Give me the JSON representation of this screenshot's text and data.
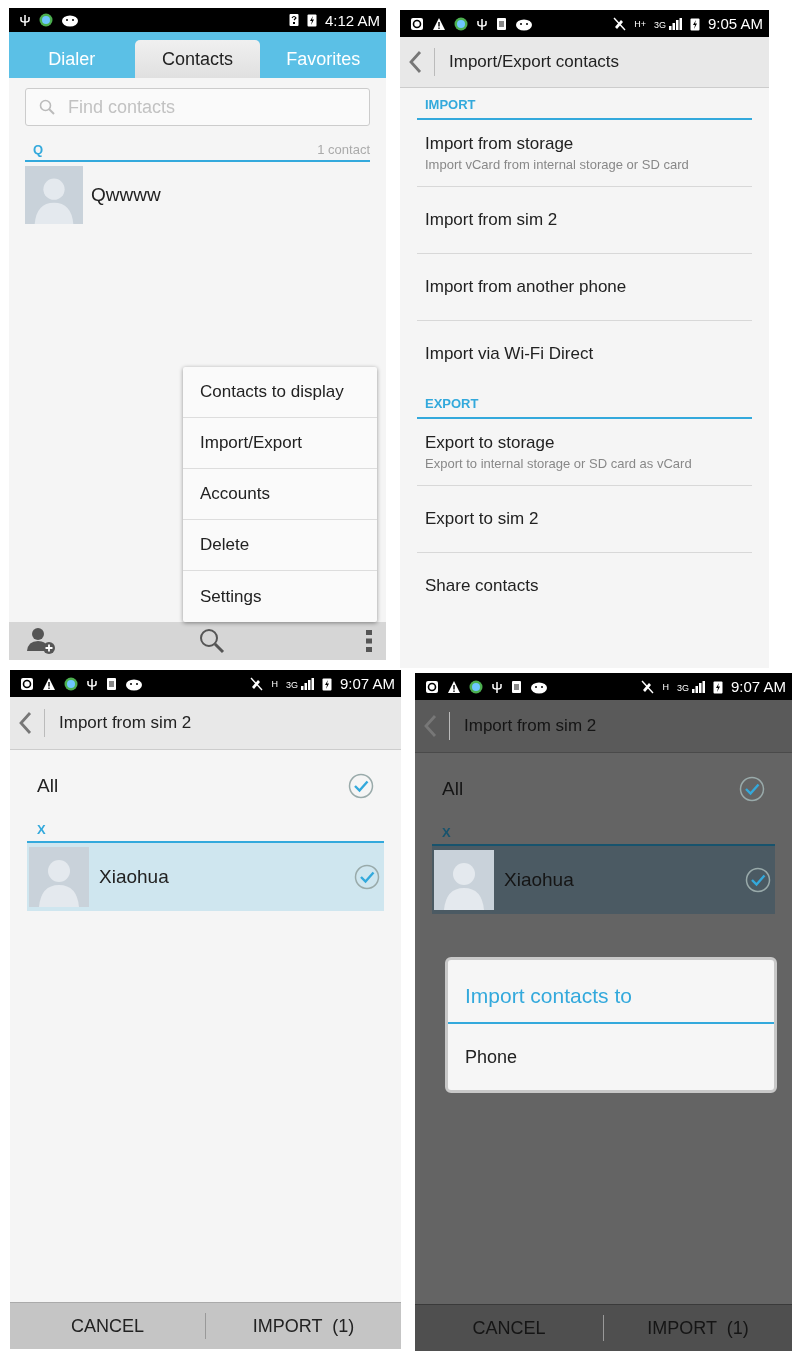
{
  "contacts_screen": {
    "status_bar": {
      "time": "4:12 AM"
    },
    "tabs": [
      {
        "label": "Dialer",
        "selected": false
      },
      {
        "label": "Contacts",
        "selected": true
      },
      {
        "label": "Favorites",
        "selected": false
      }
    ],
    "search": {
      "placeholder": "Find contacts"
    },
    "section": {
      "letter": "Q",
      "count": "1 contact"
    },
    "contacts": [
      {
        "name": "Qwwww"
      }
    ],
    "menu": [
      "Contacts to display",
      "Import/Export",
      "Accounts",
      "Delete",
      "Settings"
    ]
  },
  "import_export_screen": {
    "status_bar": {
      "network": "H+",
      "signal_type": "3G",
      "time": "9:05 AM"
    },
    "title": "Import/Export contacts",
    "sections": [
      {
        "heading": "IMPORT",
        "items": [
          {
            "title": "Import from storage",
            "subtitle": "Import vCard from internal storage or SD card"
          },
          {
            "title": "Import from sim 2"
          },
          {
            "title": "Import from another phone"
          },
          {
            "title": "Import via Wi-Fi Direct"
          }
        ]
      },
      {
        "heading": "EXPORT",
        "items": [
          {
            "title": "Export to storage",
            "subtitle": "Export to internal storage or SD card as vCard"
          },
          {
            "title": "Export to sim 2"
          },
          {
            "title": "Share contacts"
          }
        ]
      }
    ]
  },
  "import_sim_screen": {
    "status_bar": {
      "network": "H",
      "signal_type": "3G",
      "time": "9:07 AM"
    },
    "title": "Import from sim 2",
    "all": {
      "label": "All",
      "checked": true
    },
    "section": "X",
    "contacts": [
      {
        "name": "Xiaohua",
        "checked": true,
        "selected": true
      }
    ],
    "buttons": [
      "CANCEL",
      "IMPORT  (1)"
    ]
  },
  "import_dialog_screen": {
    "status_bar": {
      "network": "H",
      "signal_type": "3G",
      "time": "9:07 AM"
    },
    "title": "Import from sim 2",
    "all": {
      "label": "All",
      "checked": true
    },
    "section": "X",
    "contacts": [
      {
        "name": "Xiaohua",
        "checked": true,
        "selected": true
      }
    ],
    "buttons": [
      "CANCEL",
      "IMPORT  (1)"
    ],
    "dialog": {
      "title": "Import contacts to",
      "options": [
        "Phone"
      ]
    }
  }
}
